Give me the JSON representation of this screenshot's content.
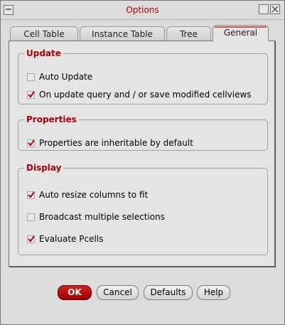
{
  "window": {
    "title": "Options"
  },
  "tabs": [
    {
      "label": "Cell Table",
      "active": false
    },
    {
      "label": "Instance Table",
      "active": false
    },
    {
      "label": "Tree",
      "active": false
    },
    {
      "label": "General",
      "active": true
    }
  ],
  "groups": {
    "update": {
      "title": "Update",
      "options": [
        {
          "label": "Auto Update",
          "checked": false
        },
        {
          "label": "On update query and / or save modified cellviews",
          "checked": true
        }
      ]
    },
    "properties": {
      "title": "Properties",
      "options": [
        {
          "label": "Properties are inheritable by default",
          "checked": true
        }
      ]
    },
    "display": {
      "title": "Display",
      "options": [
        {
          "label": "Auto resize columns to fit",
          "checked": true
        },
        {
          "label": "Broadcast multiple selections",
          "checked": false
        },
        {
          "label": "Evaluate Pcells",
          "checked": true
        }
      ]
    }
  },
  "buttons": {
    "ok": "OK",
    "cancel": "Cancel",
    "defaults": "Defaults",
    "help": "Help"
  },
  "colors": {
    "accent": "#b00000",
    "check": "#c00000"
  }
}
